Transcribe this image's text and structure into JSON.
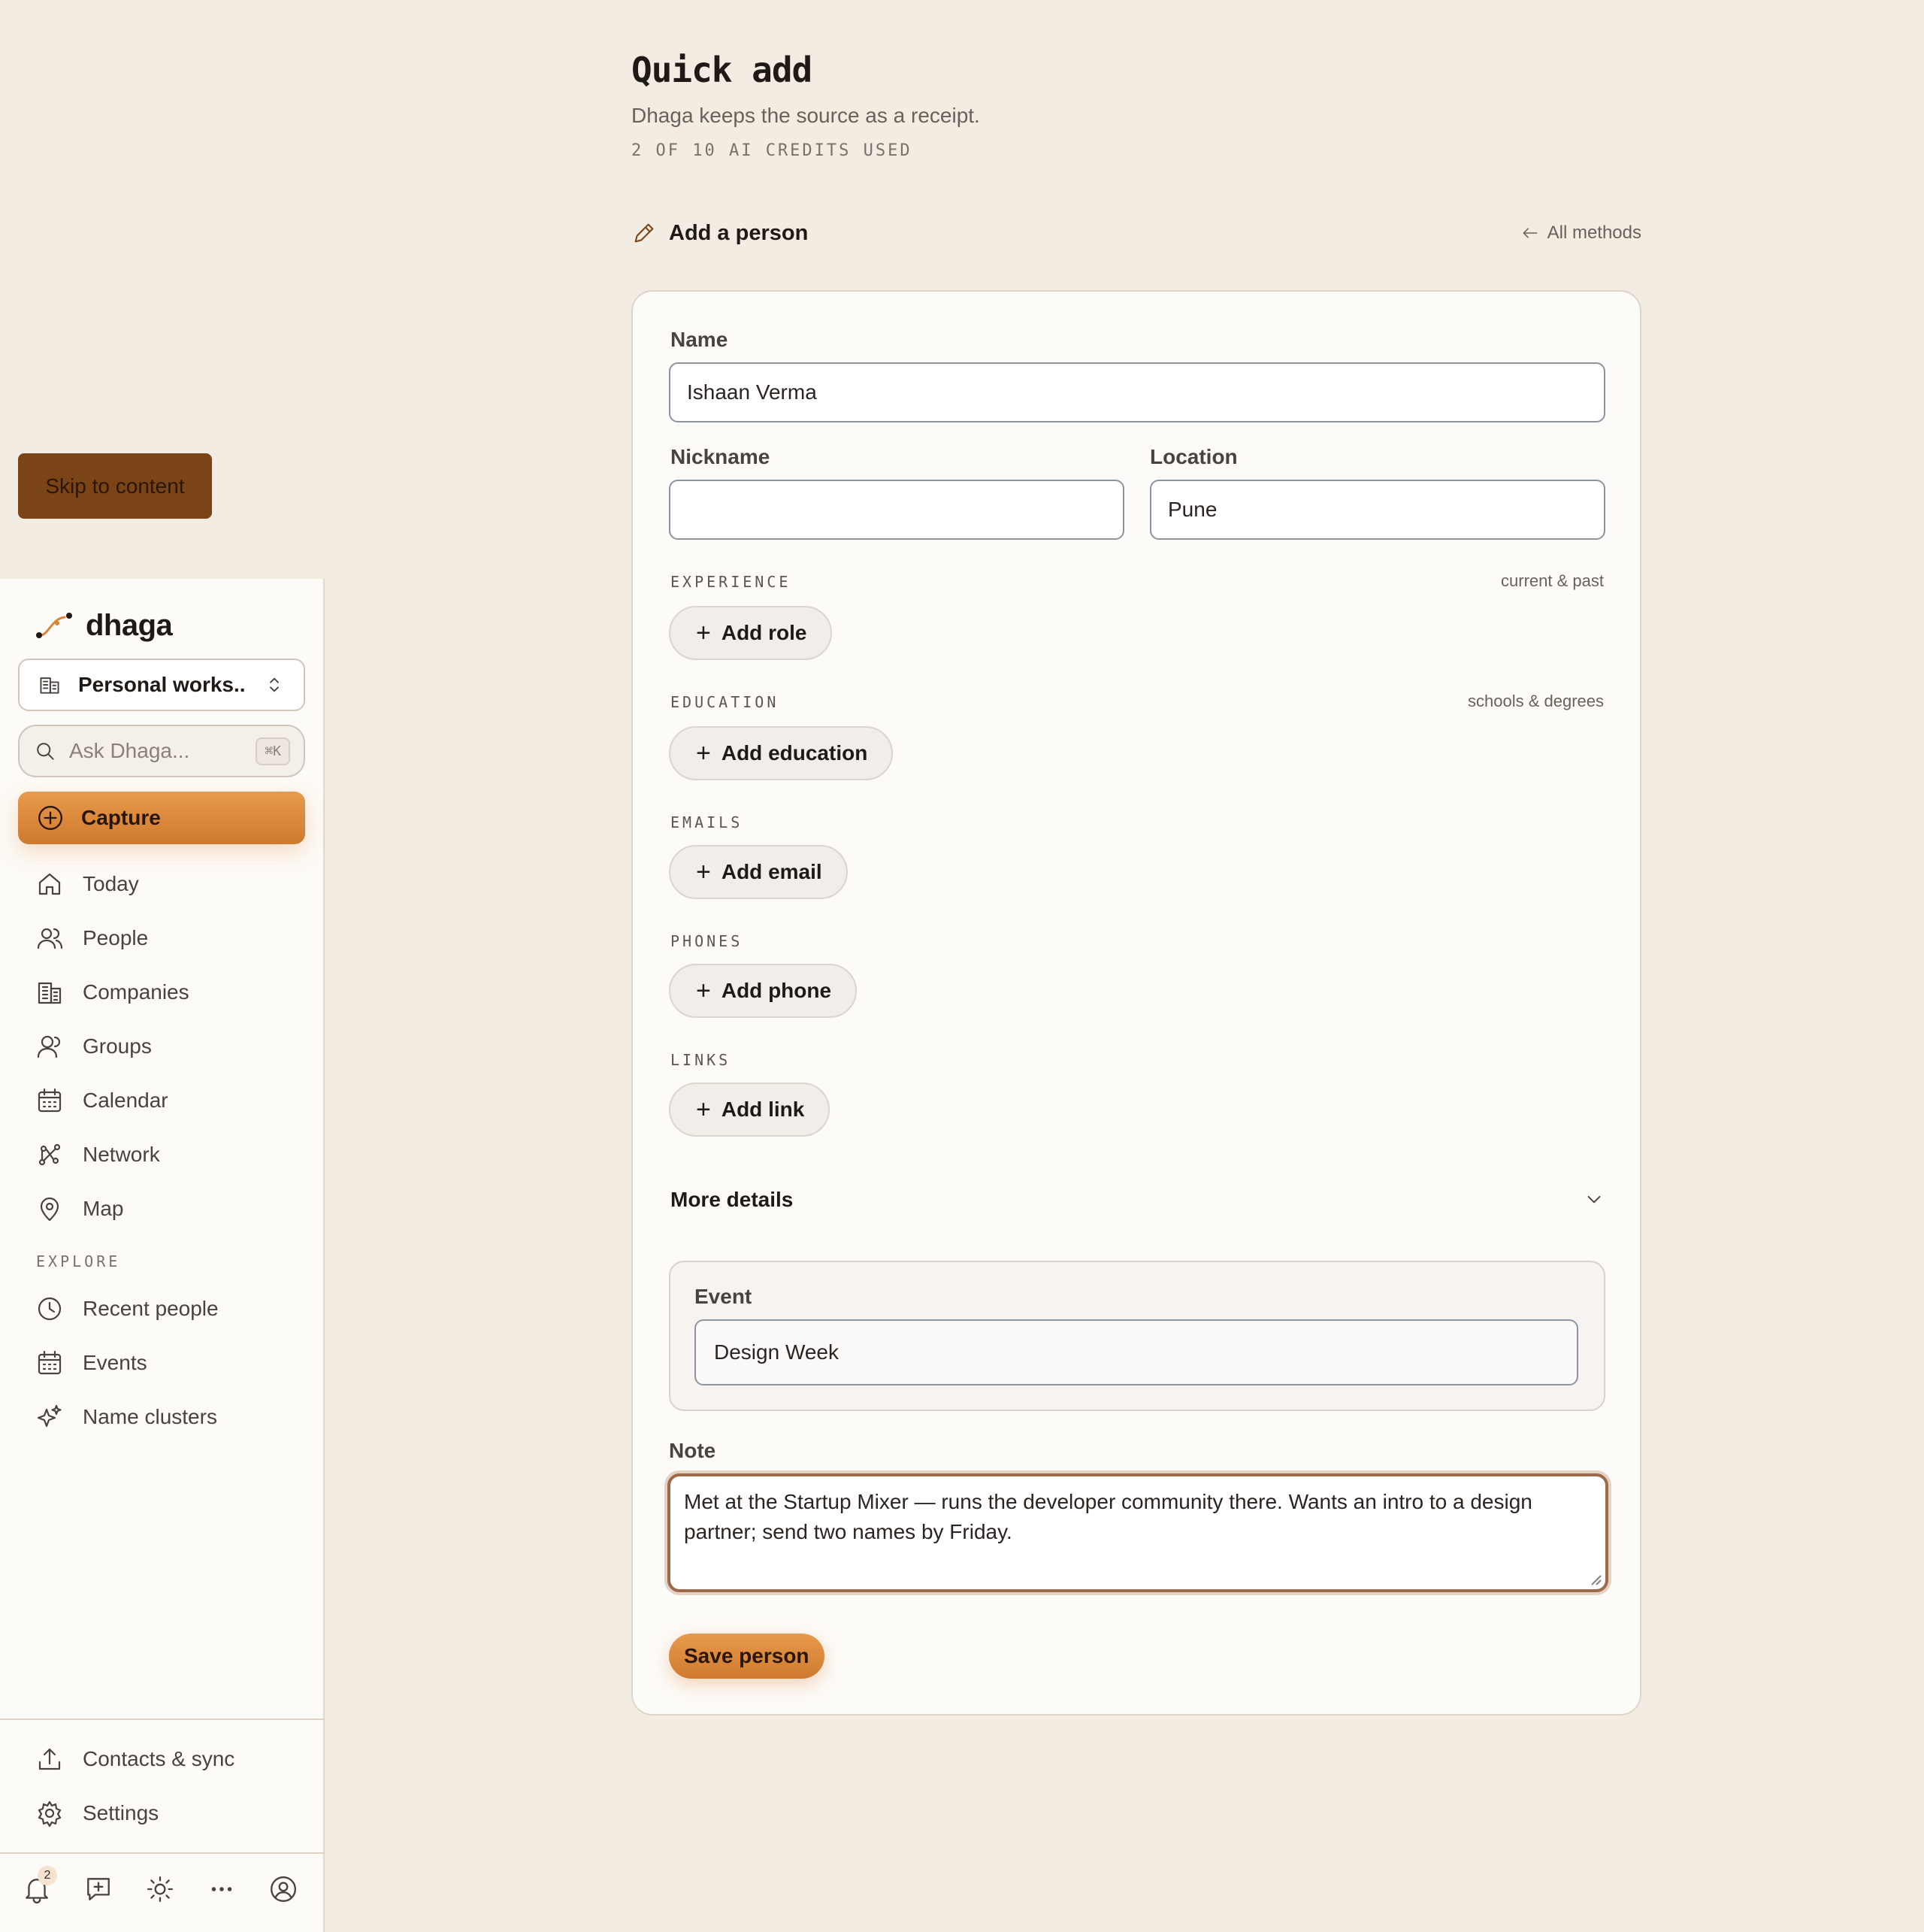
{
  "skip_link": "Skip to content",
  "sidebar": {
    "brand": "dhaga",
    "workspace": "Personal works...",
    "search": {
      "placeholder": "Ask Dhaga...",
      "shortcut": "⌘K"
    },
    "capture": "Capture",
    "nav": [
      {
        "label": "Today",
        "icon": "home-icon"
      },
      {
        "label": "People",
        "icon": "people-icon"
      },
      {
        "label": "Companies",
        "icon": "building-icon"
      },
      {
        "label": "Groups",
        "icon": "group-icon"
      },
      {
        "label": "Calendar",
        "icon": "calendar-icon"
      },
      {
        "label": "Network",
        "icon": "network-icon"
      },
      {
        "label": "Map",
        "icon": "map-pin-icon"
      }
    ],
    "explore_label": "EXPLORE",
    "explore": [
      {
        "label": "Recent people",
        "icon": "clock-icon"
      },
      {
        "label": "Events",
        "icon": "calendar-icon"
      },
      {
        "label": "Name clusters",
        "icon": "sparkles-icon"
      }
    ],
    "bottom": [
      {
        "label": "Contacts & sync",
        "icon": "upload-icon"
      },
      {
        "label": "Settings",
        "icon": "gear-icon"
      }
    ],
    "toolbar": {
      "notification_count": "2"
    }
  },
  "main": {
    "title": "Quick add",
    "subtitle": "Dhaga keeps the source as a receipt.",
    "credits": "2 OF 10 AI CREDITS USED",
    "section_title": "Add a person",
    "all_methods": "All methods",
    "form": {
      "name_label": "Name",
      "name_value": "Ishaan Verma",
      "nickname_label": "Nickname",
      "nickname_value": "",
      "location_label": "Location",
      "location_value": "Pune",
      "experience_label": "EXPERIENCE",
      "experience_hint": "current & past",
      "add_role": "Add role",
      "education_label": "EDUCATION",
      "education_hint": "schools & degrees",
      "add_education": "Add education",
      "emails_label": "EMAILS",
      "add_email": "Add email",
      "phones_label": "PHONES",
      "add_phone": "Add phone",
      "links_label": "LINKS",
      "add_link": "Add link",
      "more_details": "More details",
      "event_label": "Event",
      "event_value": "Design Week",
      "note_label": "Note",
      "note_value": "Met at the Startup Mixer — runs the developer community there. Wants an intro to a design partner; send two names by Friday.",
      "save": "Save person"
    }
  },
  "colors": {
    "accent": "#d9853a",
    "background": "#f3ece3",
    "sidebar": "#fdfbf7",
    "note_focus": "#9c6a4a"
  }
}
